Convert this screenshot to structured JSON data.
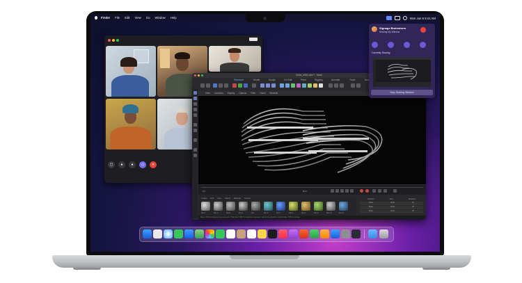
{
  "menubar": {
    "app_name": "Finder",
    "items": [
      "File",
      "Edit",
      "View",
      "Go",
      "Window",
      "Help"
    ],
    "clock": "Mon Jun 6  9:41 AM"
  },
  "facetime": {
    "participants": [
      "participant-1",
      "participant-2",
      "participant-3",
      "participant-4",
      "participant-5"
    ]
  },
  "c4d": {
    "title": "Vista_v003.c4d * - Main",
    "tabs": [
      "Standard",
      "Model",
      "Sculpt",
      "UV Edit",
      "Paint",
      "Rigging",
      "Animate",
      "Track",
      "Script"
    ],
    "viewport_menu": [
      "View",
      "Cameras",
      "Display",
      "Options",
      "Filter",
      "Panel",
      "Redshift"
    ],
    "timeline_frame": "0 F",
    "end_frame": "90 F",
    "material_menu": [
      "Create",
      "Edit",
      "View",
      "Select",
      "Material",
      "Texture"
    ],
    "materials": [
      "Mat.4",
      "Mat.3",
      "Mat.2",
      "Mat.1",
      "Mat",
      "Mat.8",
      "Mat.7",
      "Mat.6",
      "Mat.5",
      "Mat.9",
      "Mat.10",
      "Mat.11"
    ],
    "attr_headers": [
      "Position",
      "Size",
      "Rotation"
    ],
    "attr_rows": [
      [
        "0 cm",
        "0 cm",
        "0°"
      ],
      [
        "0 cm",
        "0 cm",
        "0°"
      ],
      [
        "0 cm",
        "0 cm",
        "0°"
      ]
    ],
    "statusbar": "Move: Click and drag to move elements. Hold down SHIFT to quantize movement / add to the selection in point mode, CTRL to remove."
  },
  "share": {
    "title": "Signage Brainstorm",
    "subtitle": "Sharing My Window",
    "section": "Currently Sharing",
    "stop_label": "Stop Sharing Window"
  },
  "colors": {
    "accent": "#7a6cf0",
    "end_call": "#e8423a"
  }
}
